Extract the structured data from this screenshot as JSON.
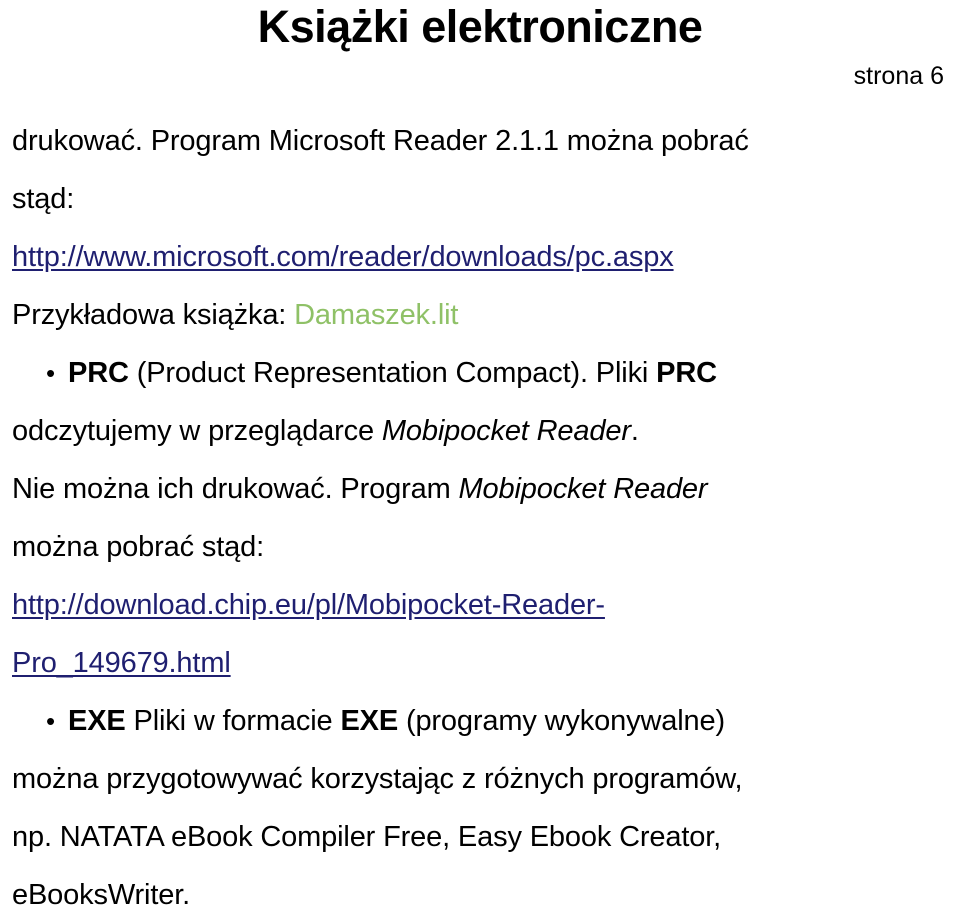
{
  "slide": {
    "title": "Książki elektroniczne",
    "page_marker": "strona 6",
    "background_color": "#ffffff",
    "text_color": "#000000",
    "link_color": "#1f1f70",
    "accent_green": "#8fc167",
    "bullet_glyph": "•"
  },
  "content": {
    "line1_a": "drukować. Program Microsoft Reader 2.1.1 można pobrać",
    "line2_a": "stąd:",
    "line3_link": "http://www.microsoft.com/reader/downloads/pc.aspx",
    "line4_a": "Przykładowa książka: ",
    "line4_b": "Damaszek.lit",
    "line5_a": "PRC",
    "line5_b": " (Product Representation Compact). Pliki ",
    "line5_c": "PRC",
    "line6_a": "odczytujemy w przeglądarce ",
    "line6_b": "Mobipocket Reader",
    "line6_c": ".",
    "line7_a": "Nie można ich drukować. Program ",
    "line7_b": "Mobipocket Reader",
    "line8_a": "można pobrać stąd:",
    "line9_link": "http://download.chip.eu/pl/Mobipocket-Reader-",
    "line10_link": "Pro_149679.html",
    "line11_a": "EXE",
    "line11_b": " Pliki w formacie ",
    "line11_c": "EXE",
    "line11_d": " (programy wykonywalne)",
    "line12_a": "można przygotowywać korzystając z różnych programów,",
    "line13_a": "np. NATATA eBook Compiler Free, Easy Ebook Creator,",
    "line14_a": "eBooksWriter."
  }
}
